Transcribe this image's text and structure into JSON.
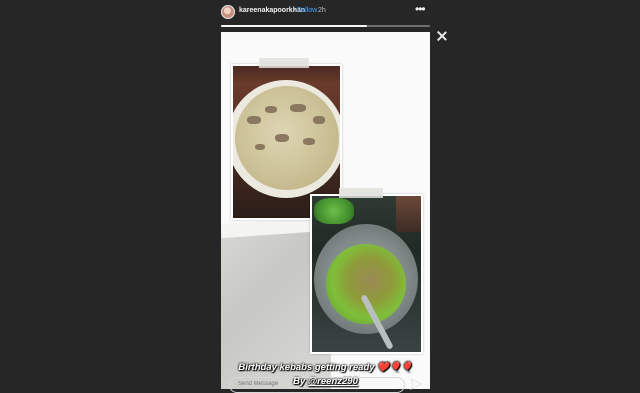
{
  "header": {
    "username": "kareenakapoorkhan",
    "separator": "•",
    "follow_label": "Follow",
    "time": "2h",
    "more_label": "•••",
    "progress_fraction": 0.7
  },
  "story": {
    "caption_line1": "Birthday kebabs getting ready ❤️🎈🎈",
    "caption_by": "By ",
    "caption_mention": "@reenz290"
  },
  "reply": {
    "placeholder": "Send Message"
  },
  "icons": {
    "more": "more-options-icon",
    "close": "close-icon",
    "send": "send-icon"
  }
}
